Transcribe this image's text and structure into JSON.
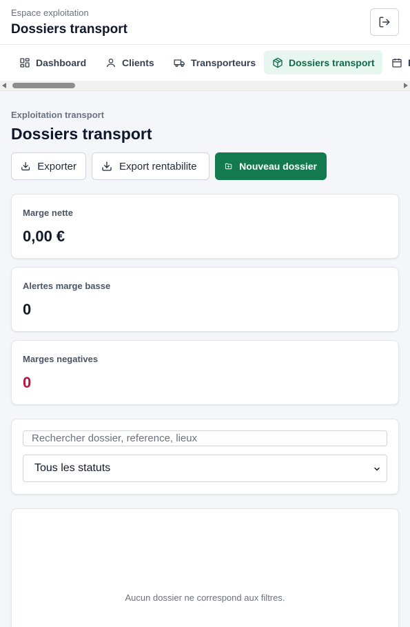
{
  "header": {
    "kicker": "Espace exploitation",
    "title": "Dossiers transport"
  },
  "nav": {
    "tabs": [
      {
        "label": "Dashboard",
        "icon": "dashboard-grid-icon"
      },
      {
        "label": "Clients",
        "icon": "user-icon"
      },
      {
        "label": "Transporteurs",
        "icon": "truck-icon"
      },
      {
        "label": "Dossiers transport",
        "icon": "package-icon",
        "active": true
      },
      {
        "label": "P",
        "icon": "calendar-icon"
      }
    ]
  },
  "page": {
    "subtitle": "Exploitation transport",
    "title": "Dossiers transport"
  },
  "actions": {
    "export": "Exporter",
    "export_rentabilite": "Export rentabilite",
    "new_dossier": "Nouveau dossier"
  },
  "kpis": {
    "marge_nette": {
      "label": "Marge nette",
      "value": "0,00 €"
    },
    "alertes": {
      "label": "Alertes marge basse",
      "value": "0"
    },
    "negatives": {
      "label": "Marges negatives",
      "value": "0"
    }
  },
  "filters": {
    "search_placeholder": "Rechercher dossier, reference, lieux",
    "status_selected": "Tous les statuts"
  },
  "empty_state": {
    "message": "Aucun dossier ne correspond aux filtres."
  },
  "colors": {
    "primary": "#137a4f",
    "active_tab_bg": "#e7f7ef",
    "negative": "#be123c"
  }
}
